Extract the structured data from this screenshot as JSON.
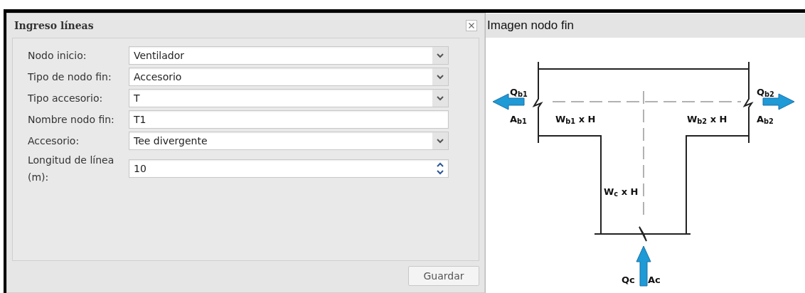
{
  "dialog": {
    "title": "Ingreso líneas",
    "fields": [
      {
        "label": "Nodo inicio:",
        "value": "Ventilador",
        "kind": "select"
      },
      {
        "label": "Tipo de nodo fin:",
        "value": "Accesorio",
        "kind": "select"
      },
      {
        "label": "Tipo accesorio:",
        "value": "T",
        "kind": "select"
      },
      {
        "label": "Nombre nodo fin:",
        "value": "T1",
        "kind": "text"
      },
      {
        "label": "Accesorio:",
        "value": "Tee divergente",
        "kind": "select"
      },
      {
        "label": "Longitud de línea (m):",
        "value": "10",
        "kind": "number"
      }
    ],
    "save_button": "Guardar"
  },
  "preview": {
    "title": "Imagen nodo fin",
    "diagram_labels": [
      "Q$_{b1}$",
      "A$_{b1}$",
      "W$_{b1}$ x H",
      "W$_{b2}$ x H",
      "Q$_{b2}$",
      "A$_{b2}$",
      "W$_{c}$ x H",
      "Qc",
      "Ac"
    ]
  }
}
